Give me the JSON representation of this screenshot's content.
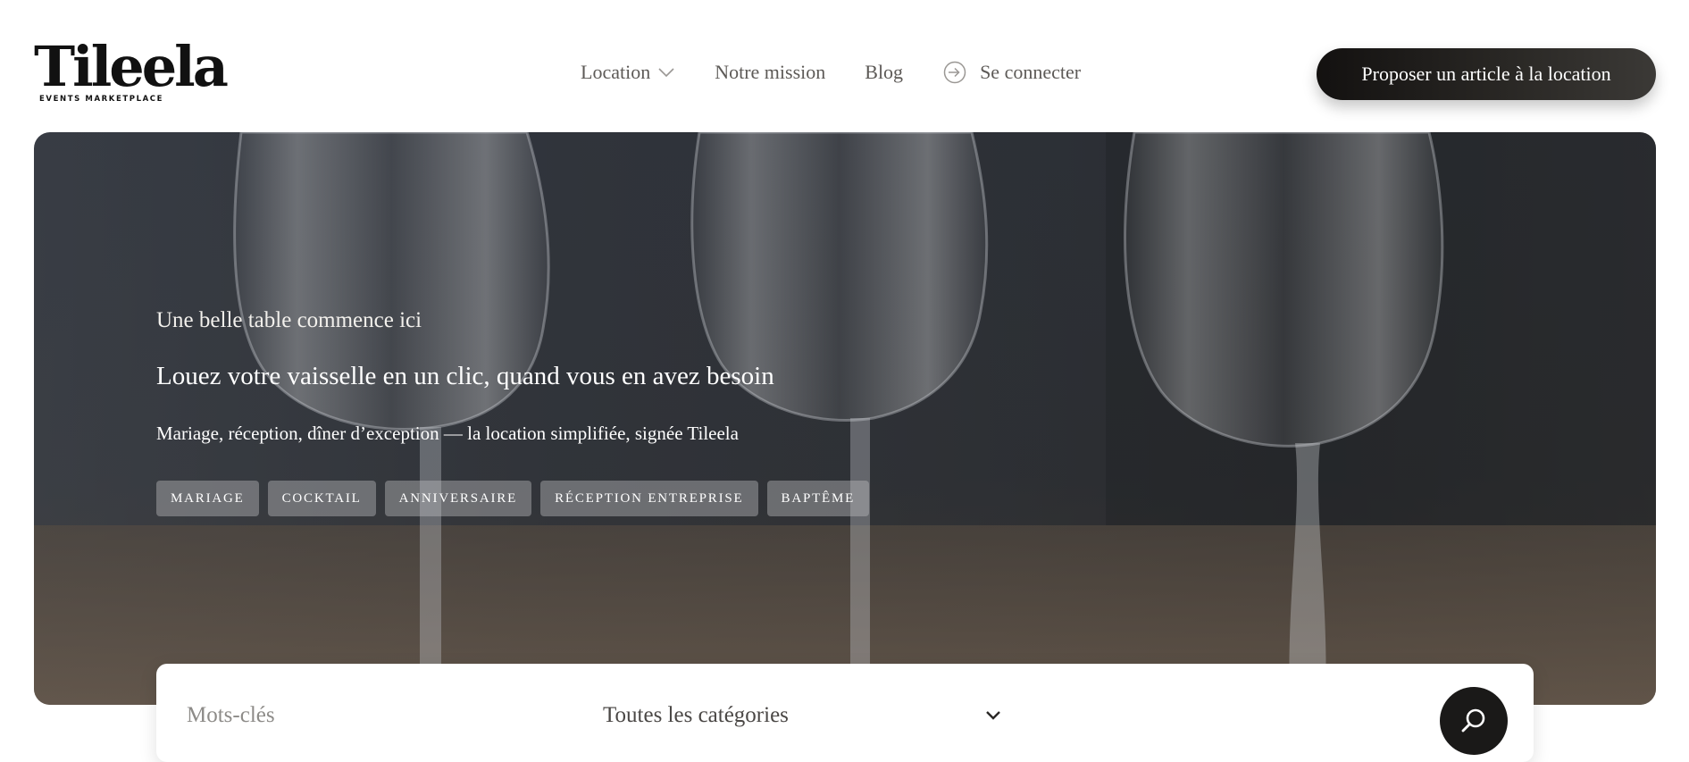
{
  "brand": {
    "logo_word": "Tileela",
    "logo_tagline": "EVENTS MARKETPLACE"
  },
  "nav": {
    "location": "Location",
    "mission": "Notre mission",
    "blog": "Blog",
    "login": "Se connecter"
  },
  "cta": {
    "label": "Proposer un article à la location"
  },
  "hero": {
    "eyebrow": "Une belle table commence ici",
    "title": "Louez votre vaisselle en un clic, quand vous en avez besoin",
    "subtitle": "Mariage, réception, dîner d’exception — la location simplifiée, signée Tileela",
    "tags": [
      "MARIAGE",
      "COCKTAIL",
      "ANNIVERSAIRE",
      "RÉCEPTION ENTREPRISE",
      "BAPTÊME"
    ]
  },
  "search": {
    "keywords_placeholder": "Mots-clés",
    "category_value": "Toutes les catégories"
  },
  "icons": {
    "location_dropdown": "chevron-down-icon",
    "login": "login-arrow-icon",
    "category_dropdown": "chevron-down-icon",
    "search": "search-icon"
  },
  "colors": {
    "cta_background": "#131110",
    "nav_text": "#5d5a57",
    "tag_background": "#9d9d9f",
    "search_button": "#1a1918"
  }
}
